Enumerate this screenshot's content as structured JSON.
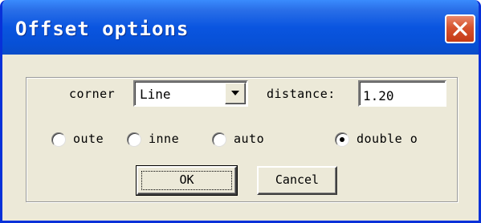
{
  "window": {
    "title": "Offset options",
    "close_icon": "close-x-icon"
  },
  "colors": {
    "title_bar": "#0a55e0",
    "window_border": "#0831d9",
    "dialog_bg": "#ece9d8",
    "close_button": "#d6532e"
  },
  "form": {
    "corner_label": "corner",
    "corner_value": "Line",
    "distance_label": "distance:",
    "distance_value": "1.20"
  },
  "radios": [
    {
      "label": "oute",
      "selected": false
    },
    {
      "label": "inne",
      "selected": false
    },
    {
      "label": "auto",
      "selected": false
    },
    {
      "label": "double o",
      "selected": true
    }
  ],
  "buttons": {
    "ok": "OK",
    "cancel": "Cancel"
  }
}
